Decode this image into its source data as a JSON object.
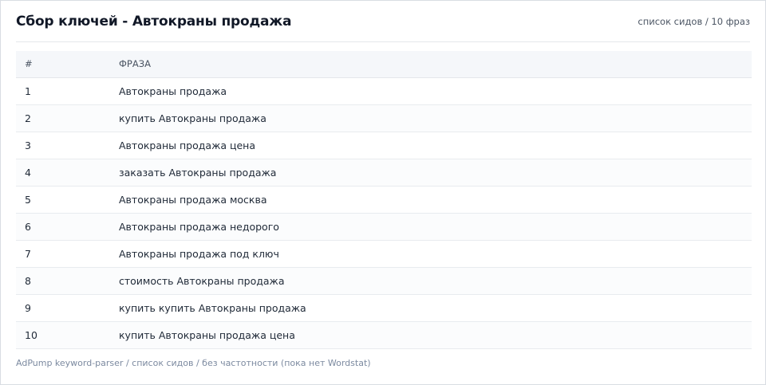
{
  "header": {
    "title": "Сбор ключей - Автокраны продажа",
    "subtitle": "список сидов / 10 фраз"
  },
  "table": {
    "columns": [
      "#",
      "ФРАЗА"
    ],
    "rows": [
      {
        "num": "1",
        "phrase": "Автокраны продажа"
      },
      {
        "num": "2",
        "phrase": "купить Автокраны продажа"
      },
      {
        "num": "3",
        "phrase": "Автокраны продажа цена"
      },
      {
        "num": "4",
        "phrase": "заказать Автокраны продажа"
      },
      {
        "num": "5",
        "phrase": "Автокраны продажа москва"
      },
      {
        "num": "6",
        "phrase": "Автокраны продажа недорого"
      },
      {
        "num": "7",
        "phrase": "Автокраны продажа под ключ"
      },
      {
        "num": "8",
        "phrase": "стоимость Автокраны продажа"
      },
      {
        "num": "9",
        "phrase": "купить купить Автокраны продажа"
      },
      {
        "num": "10",
        "phrase": "купить Автокраны продажа цена"
      }
    ]
  },
  "footer": {
    "text": "AdPump keyword-parser / список сидов / без частотности (пока нет Wordstat)"
  }
}
